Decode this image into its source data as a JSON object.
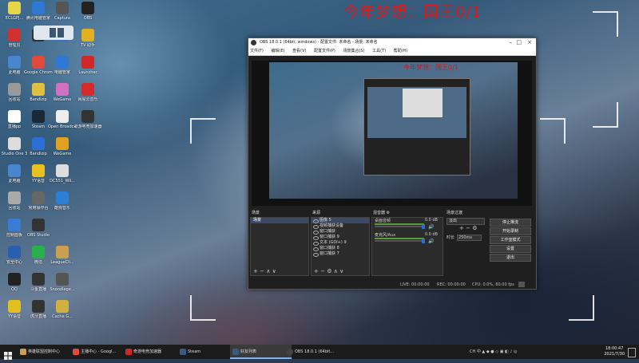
{
  "wallpaper_title": "今年梦想：国王0/1",
  "desktop_icons": [
    {
      "label": "ECLGPJ...",
      "color": "#e8d64a",
      "col": 0,
      "row": 0
    },
    {
      "label": "腾讯电脑管家",
      "color": "#2f78d6",
      "col": 1,
      "row": 0
    },
    {
      "label": "Captura",
      "color": "#555",
      "col": 2,
      "row": 0
    },
    {
      "label": "OBS",
      "color": "#222",
      "col": 3,
      "row": 0
    },
    {
      "label": "管理员",
      "color": "#d03030",
      "col": 0,
      "row": 1
    },
    {
      "label": "",
      "color": "#333",
      "col": 1,
      "row": 1
    },
    {
      "label": "",
      "color": "#3b6fbf",
      "col": 2,
      "row": 1
    },
    {
      "label": "TV 助手",
      "color": "#e0b020",
      "col": 3,
      "row": 1
    },
    {
      "label": "此电脑",
      "color": "#4a86cf",
      "col": 0,
      "row": 2
    },
    {
      "label": "Google Chrome",
      "color": "#e04a3a",
      "col": 1,
      "row": 2
    },
    {
      "label": "电脑管家",
      "color": "#2f78d6",
      "col": 2,
      "row": 2
    },
    {
      "label": "Launcher",
      "color": "#d02828",
      "col": 3,
      "row": 2
    },
    {
      "label": "回收站",
      "color": "#999",
      "col": 0,
      "row": 3
    },
    {
      "label": "Bandizip",
      "color": "#e0c040",
      "col": 1,
      "row": 3
    },
    {
      "label": "WeGame",
      "color": "#d070c0",
      "col": 2,
      "row": 3
    },
    {
      "label": "网易云音乐",
      "color": "#d62a2a",
      "col": 3,
      "row": 3
    },
    {
      "label": "直播pp",
      "color": "#fff",
      "col": 0,
      "row": 4
    },
    {
      "label": "Steam",
      "color": "#1b2838",
      "col": 1,
      "row": 4
    },
    {
      "label": "Open Broadcast...",
      "color": "#eee",
      "col": 2,
      "row": 4
    },
    {
      "label": "歌游电竞加速器",
      "color": "#333",
      "col": 3,
      "row": 4
    },
    {
      "label": "Studio One 3",
      "color": "#ddd",
      "col": 0,
      "row": 5
    },
    {
      "label": "Bandizip",
      "color": "#2b6fd6",
      "col": 1,
      "row": 5
    },
    {
      "label": "WeGame",
      "color": "#e0a020",
      "col": 2,
      "row": 5
    },
    {
      "label": "",
      "color": "",
      "col": 3,
      "row": 5
    },
    {
      "label": "此电脑",
      "color": "#4a86cf",
      "col": 0,
      "row": 6
    },
    {
      "label": "YY语音",
      "color": "#e8c020",
      "col": 1,
      "row": 6
    },
    {
      "label": "DC551_Wil...",
      "color": "#ddd",
      "col": 2,
      "row": 6
    },
    {
      "label": "回收站",
      "color": "#aaa",
      "col": 0,
      "row": 7
    },
    {
      "label": "常用操作台",
      "color": "#666",
      "col": 1,
      "row": 7
    },
    {
      "label": "酷狗音乐",
      "color": "#2a7fd6",
      "col": 2,
      "row": 7
    },
    {
      "label": "控制面板",
      "color": "#3a7bd5",
      "col": 0,
      "row": 8
    },
    {
      "label": "OBS Studio",
      "color": "#333",
      "col": 1,
      "row": 8
    },
    {
      "label": "",
      "color": "",
      "col": 2,
      "row": 8
    },
    {
      "label": "安全中心",
      "color": "#2a5fb0",
      "col": 0,
      "row": 9
    },
    {
      "label": "微信",
      "color": "#2ab04a",
      "col": 1,
      "row": 9
    },
    {
      "label": "LeagueCli...",
      "color": "#c8a050",
      "col": 2,
      "row": 9
    },
    {
      "label": "QQ",
      "color": "#222",
      "col": 0,
      "row": 10
    },
    {
      "label": "斗鱼直播",
      "color": "#333",
      "col": 1,
      "row": 10
    },
    {
      "label": "Snoodlege...",
      "color": "#555",
      "col": 2,
      "row": 10
    },
    {
      "label": "YY语音",
      "color": "#e0c020",
      "col": 0,
      "row": 11
    },
    {
      "label": "虎牙直播",
      "color": "#333",
      "col": 1,
      "row": 11
    },
    {
      "label": "Cache G...",
      "color": "#d0b040",
      "col": 2,
      "row": 11
    }
  ],
  "obs": {
    "title": "OBS 18.0.1 (64bit, windows) - 配置文件: 未命名 - 场景: 未命名",
    "menu": [
      "文件(F)",
      "编辑(E)",
      "查看(V)",
      "配置文件(P)",
      "场景集合(S)",
      "工具(T)",
      "帮助(H)"
    ],
    "preview_title": "今年梦想：国王0/1",
    "scenes": {
      "header": "场景",
      "items": [
        "场景"
      ]
    },
    "sources": {
      "header": "来源",
      "items": [
        "图像 5",
        "视频捕获设备",
        "窗口捕获",
        "窗口捕获 9",
        "文本 (GDI+) 9",
        "窗口捕获 8",
        "窗口捕获 7"
      ]
    },
    "mixer": {
      "header": "混音器",
      "rows": [
        {
          "name": "桌面音频",
          "db": "0.0 dB"
        },
        {
          "name": "麦克风/Aux",
          "db": "0.0 dB"
        }
      ]
    },
    "transitions": {
      "header": "场景过渡",
      "selected": "淡出",
      "duration_label": "时长",
      "duration": "250ms"
    },
    "controls": [
      "停止推流",
      "开始录制",
      "工作室模式",
      "设置",
      "退出"
    ],
    "status": {
      "live": "LIVE: 00:00:00",
      "rec": "REC: 00:00:00",
      "cpu": "CPU: 0.0%, 60.00 fps"
    }
  },
  "taskbar": {
    "items": [
      {
        "label": "英雄联盟控制中心",
        "color": "#c8a050",
        "active": false
      },
      {
        "label": "主播中心 - Googl...",
        "color": "#e04a3a",
        "active": false
      },
      {
        "label": "奇游电竞加速器",
        "color": "#d02828",
        "active": false
      },
      {
        "label": "Steam",
        "color": "#1b2838",
        "active": false
      },
      {
        "label": "好友列表",
        "color": "#1b2838",
        "active": true
      },
      {
        "label": "OBS 18.0.1 (64bit...",
        "color": "#333",
        "active": false
      }
    ],
    "tray": "CH 中",
    "time": "18:00:47",
    "date": "2021/7/30"
  }
}
